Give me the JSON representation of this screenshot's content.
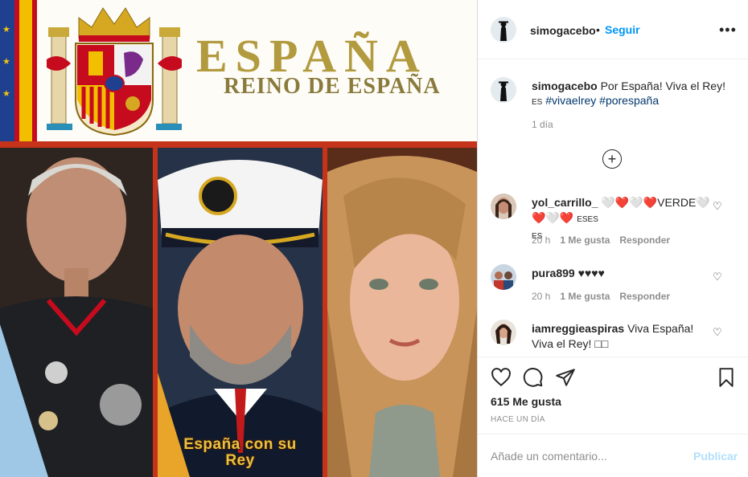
{
  "post_image": {
    "banner_title": "ESPAÑA",
    "banner_subtitle": "REINO DE ESPAÑA",
    "caption_overlay_line1": "España con su",
    "caption_overlay_line2": "Rey"
  },
  "header": {
    "username": "simogacebo",
    "separator": "•",
    "follow_label": "Seguir",
    "more_label": "•••"
  },
  "caption": {
    "username": "simogacebo",
    "text": "Por España! Viva el Rey!",
    "flag_text": "ES",
    "hashtags": [
      "#vivaelrey",
      "#porespaña"
    ],
    "time": "1 día",
    "load_more_label": "+"
  },
  "comments": [
    {
      "username": "yol_carrillo_",
      "text_part1": "🤍❤️🤍❤️VERDE🤍❤️🤍❤️",
      "flag_a": "ES",
      "flag_b": "ES",
      "flag_c": "ES",
      "time": "20 h",
      "likes": "1 Me gusta",
      "reply": "Responder"
    },
    {
      "username": "pura899",
      "text": "♥♥♥♥",
      "time": "20 h",
      "likes": "1 Me gusta",
      "reply": "Responder"
    },
    {
      "username": "iamreggieaspiras",
      "text": "Viva España! Viva el Rey! □□"
    }
  ],
  "actions": {
    "likes": "615 Me gusta",
    "posted_ago": "HACE UN DÍA"
  },
  "add_comment": {
    "placeholder": "Añade un comentario...",
    "publish_label": "Publicar"
  },
  "colors": {
    "link_blue": "#0095f6",
    "hashtag_blue": "#00376b",
    "muted": "#8e8e8e",
    "publish_disabled": "#b2dffc",
    "banner_gold": "#b29a3e",
    "frame_red": "#c6331b"
  }
}
